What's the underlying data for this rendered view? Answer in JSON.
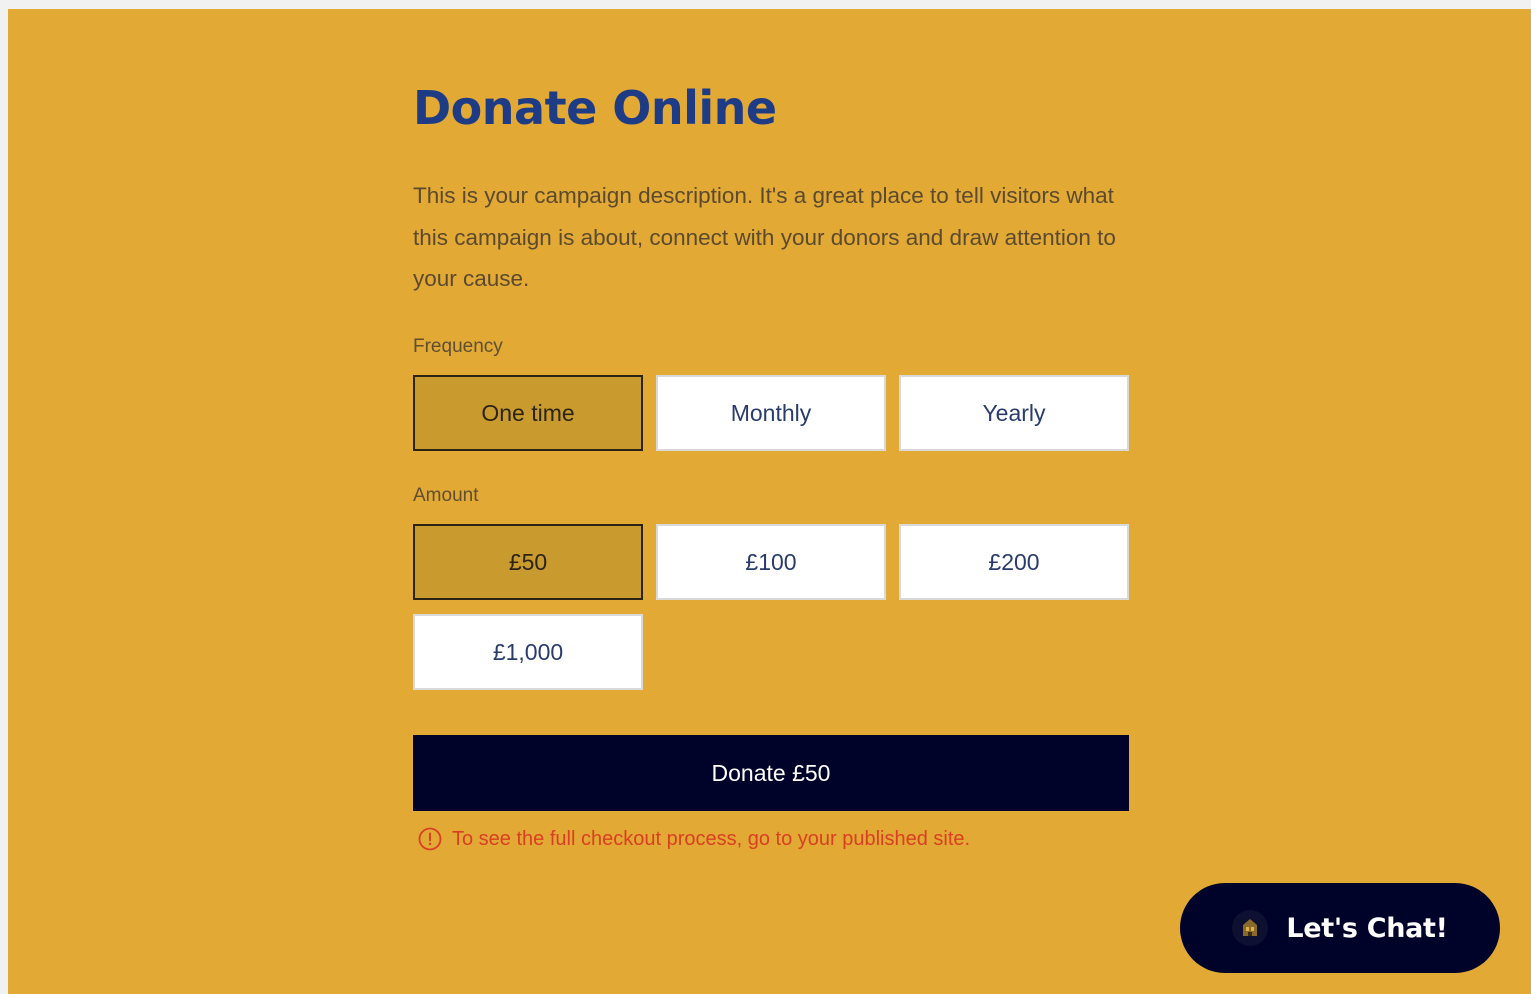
{
  "page": {
    "title": "Donate Online",
    "description": "This is your campaign description. It's a great place to tell visitors what this campaign is about, connect with your donors and draw attention to your cause."
  },
  "frequency": {
    "label": "Frequency",
    "options": [
      "One time",
      "Monthly",
      "Yearly"
    ],
    "selected": "One time"
  },
  "amount": {
    "label": "Amount",
    "options": [
      "£50",
      "£100",
      "£200",
      "£1,000"
    ],
    "selected": "£50"
  },
  "donate_button": {
    "label": "Donate £50"
  },
  "notice": {
    "text": "To see the full checkout process, go to your published site.",
    "icon": "alert-circle-icon"
  },
  "chat": {
    "label": "Let's Chat!",
    "icon": "chat-avatar-icon"
  },
  "colors": {
    "background": "#e2a935",
    "title": "#1e3b86",
    "selected_option": "#c99a2e",
    "primary_button": "#000329",
    "notice": "#d93f22"
  }
}
